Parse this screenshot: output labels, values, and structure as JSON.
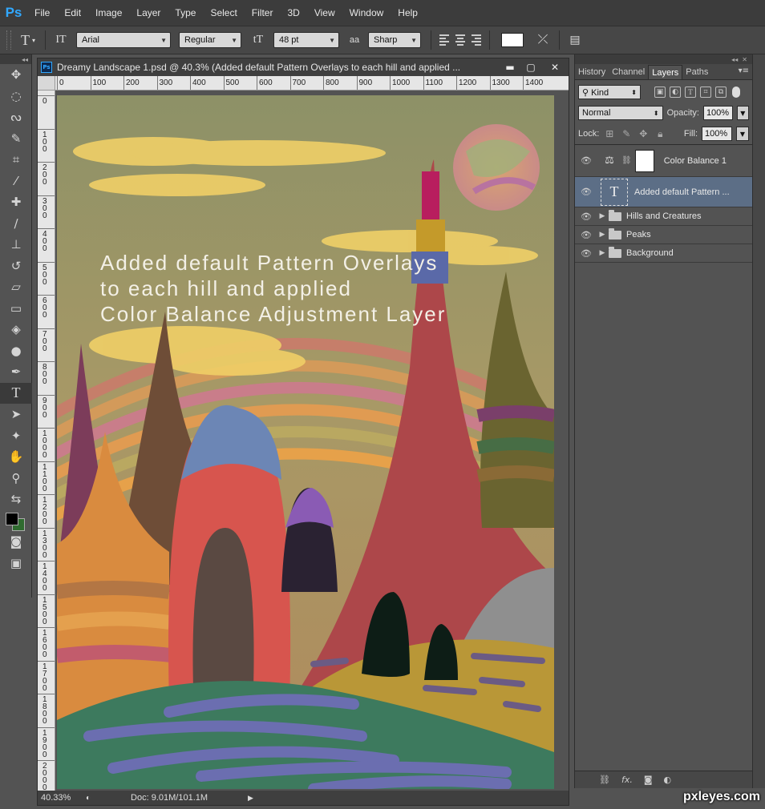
{
  "app": {
    "logo": "Ps"
  },
  "menu": [
    "File",
    "Edit",
    "Image",
    "Layer",
    "Type",
    "Select",
    "Filter",
    "3D",
    "View",
    "Window",
    "Help"
  ],
  "options": {
    "tool_icon": "T",
    "orient_icon": "IT",
    "font_family": "Arial",
    "font_style": "Regular",
    "size_icon": "tT",
    "font_size": "48 pt",
    "aa_icon": "aa",
    "antialias": "Sharp",
    "text_color": "#ffffff"
  },
  "tools": [
    {
      "icon": "move-icon",
      "glyph": "✥"
    },
    {
      "icon": "marquee-icon",
      "glyph": "◌"
    },
    {
      "icon": "lasso-icon",
      "glyph": "ᔓ"
    },
    {
      "icon": "quick-select-icon",
      "glyph": "✎"
    },
    {
      "icon": "crop-icon",
      "glyph": "⌗"
    },
    {
      "icon": "eyedropper-icon",
      "glyph": "⁄"
    },
    {
      "icon": "healing-icon",
      "glyph": "✚"
    },
    {
      "icon": "brush-icon",
      "glyph": "∕"
    },
    {
      "icon": "stamp-icon",
      "glyph": "⊥"
    },
    {
      "icon": "history-brush-icon",
      "glyph": "↺"
    },
    {
      "icon": "eraser-icon",
      "glyph": "▱"
    },
    {
      "icon": "gradient-icon",
      "glyph": "▭"
    },
    {
      "icon": "blur-icon",
      "glyph": "◈"
    },
    {
      "icon": "dodge-icon",
      "glyph": "●"
    },
    {
      "icon": "pen-icon",
      "glyph": "✒"
    },
    {
      "icon": "type-icon",
      "glyph": "T"
    },
    {
      "icon": "path-select-icon",
      "glyph": "➤"
    },
    {
      "icon": "shape-icon",
      "glyph": "✦"
    },
    {
      "icon": "hand-icon",
      "glyph": "✋"
    },
    {
      "icon": "zoom-icon",
      "glyph": "⚲"
    },
    {
      "icon": "swap-colors-icon",
      "glyph": "⇆"
    },
    {
      "icon": "color-swatches-icon",
      "glyph": ""
    },
    {
      "icon": "quick-mask-icon",
      "glyph": "◙"
    },
    {
      "icon": "screen-mode-icon",
      "glyph": "▣"
    }
  ],
  "document": {
    "title": "Dreamy Landscape 1.psd @ 40.3% (Added default Pattern Overlays to each hill and applied ...",
    "ruler_h": [
      "0",
      "100",
      "200",
      "300",
      "400",
      "500",
      "600",
      "700",
      "800",
      "900",
      "1000",
      "1100",
      "1200",
      "1300",
      "1400"
    ],
    "ruler_v": [
      "0",
      "1 0 0",
      "2 0 0",
      "3 0 0",
      "4 0 0",
      "5 0 0",
      "6 0 0",
      "7 0 0",
      "8 0 0",
      "9 0 0",
      "1 0 0 0",
      "1 1 0 0",
      "1 2 0 0",
      "1 3 0 0",
      "1 4 0 0",
      "1 5 0 0",
      "1 6 0 0",
      "1 7 0 0",
      "1 8 0 0",
      "1 9 0 0",
      "2 0 0 0"
    ],
    "zoom": "40.33%",
    "doc_info": "Doc: 9.01M/101.1M",
    "canvas_text": [
      "Added default Pattern Overlays",
      "to each hill and applied",
      "Color Balance Adjustment Layer"
    ]
  },
  "panel": {
    "tabs": [
      "History",
      "Channel",
      "Layers",
      "Paths"
    ],
    "active_tab": "Layers",
    "filter_kind": "Kind",
    "blend_mode": "Normal",
    "opacity_label": "Opacity:",
    "opacity": "100%",
    "lock_label": "Lock:",
    "fill_label": "Fill:",
    "fill": "100%",
    "layers": [
      {
        "name": "Color Balance 1",
        "type": "adjustment"
      },
      {
        "name": "Added default Pattern ...",
        "type": "text",
        "selected": true
      },
      {
        "name": "Hills and Creatures",
        "type": "group"
      },
      {
        "name": "Peaks",
        "type": "group"
      },
      {
        "name": "Background",
        "type": "group"
      }
    ],
    "bottom_icons": [
      "link-icon",
      "fx-icon",
      "mask-icon",
      "adjustment-icon"
    ]
  },
  "watermark": "pxleyes.com",
  "colors": {
    "accent": "#31a8ff",
    "selected_layer": "#5c6e86"
  }
}
